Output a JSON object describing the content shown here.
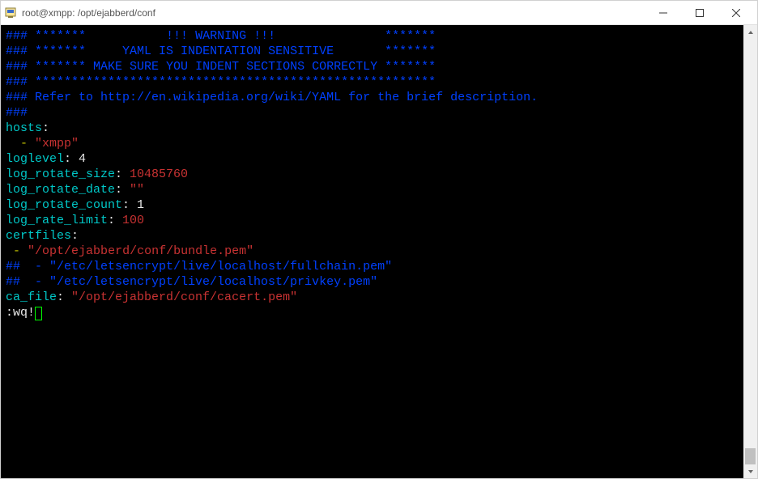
{
  "titlebar": {
    "title": "root@xmpp: /opt/ejabberd/conf"
  },
  "terminal": {
    "lines": [
      [
        {
          "cls": "c-blue",
          "text": "###"
        },
        {
          "cls": "c-white",
          "text": " "
        },
        {
          "cls": "c-blue",
          "text": "*******           !!! WARNING !!!               *******"
        }
      ],
      [
        {
          "cls": "c-blue",
          "text": "###"
        },
        {
          "cls": "c-white",
          "text": " "
        },
        {
          "cls": "c-blue",
          "text": "*******     YAML IS INDENTATION SENSITIVE       *******"
        }
      ],
      [
        {
          "cls": "c-blue",
          "text": "###"
        },
        {
          "cls": "c-white",
          "text": " "
        },
        {
          "cls": "c-blue",
          "text": "******* MAKE SURE YOU INDENT SECTIONS CORRECTLY *******"
        }
      ],
      [
        {
          "cls": "c-blue",
          "text": "###"
        },
        {
          "cls": "c-white",
          "text": " "
        },
        {
          "cls": "c-blue",
          "text": "*******************************************************"
        }
      ],
      [
        {
          "cls": "c-blue",
          "text": "### Refer to http://en.wikipedia.org/wiki/YAML for the brief description."
        }
      ],
      [
        {
          "cls": "c-blue",
          "text": "###"
        }
      ],
      [
        {
          "cls": "c-white",
          "text": ""
        }
      ],
      [
        {
          "cls": "c-cyan",
          "text": "hosts"
        },
        {
          "cls": "c-white",
          "text": ":"
        }
      ],
      [
        {
          "cls": "c-white",
          "text": "  "
        },
        {
          "cls": "c-yellow",
          "text": "-"
        },
        {
          "cls": "c-white",
          "text": " "
        },
        {
          "cls": "c-red",
          "text": "\"xmpp\""
        }
      ],
      [
        {
          "cls": "c-white",
          "text": ""
        }
      ],
      [
        {
          "cls": "c-cyan",
          "text": "loglevel"
        },
        {
          "cls": "c-white",
          "text": ": 4"
        }
      ],
      [
        {
          "cls": "c-cyan",
          "text": "log_rotate_size"
        },
        {
          "cls": "c-white",
          "text": ": "
        },
        {
          "cls": "c-red",
          "text": "10485760"
        }
      ],
      [
        {
          "cls": "c-cyan",
          "text": "log_rotate_date"
        },
        {
          "cls": "c-white",
          "text": ": "
        },
        {
          "cls": "c-red",
          "text": "\"\""
        }
      ],
      [
        {
          "cls": "c-cyan",
          "text": "log_rotate_count"
        },
        {
          "cls": "c-white",
          "text": ": 1"
        }
      ],
      [
        {
          "cls": "c-cyan",
          "text": "log_rate_limit"
        },
        {
          "cls": "c-white",
          "text": ": "
        },
        {
          "cls": "c-red",
          "text": "100"
        }
      ],
      [
        {
          "cls": "c-white",
          "text": ""
        }
      ],
      [
        {
          "cls": "c-cyan",
          "text": "certfiles"
        },
        {
          "cls": "c-white",
          "text": ":"
        }
      ],
      [
        {
          "cls": "c-white",
          "text": " "
        },
        {
          "cls": "c-yellow",
          "text": "-"
        },
        {
          "cls": "c-white",
          "text": " "
        },
        {
          "cls": "c-red",
          "text": "\"/opt/ejabberd/conf/bundle.pem\""
        }
      ],
      [
        {
          "cls": "c-blue",
          "text": "##  - \"/etc/letsencrypt/live/localhost/fullchain.pem\""
        }
      ],
      [
        {
          "cls": "c-blue",
          "text": "##  - \"/etc/letsencrypt/live/localhost/privkey.pem\""
        }
      ],
      [
        {
          "cls": "c-white",
          "text": ""
        }
      ],
      [
        {
          "cls": "c-cyan",
          "text": "ca_file"
        },
        {
          "cls": "c-white",
          "text": ": "
        },
        {
          "cls": "c-red",
          "text": "\"/opt/ejabberd/conf/cacert.pem\""
        }
      ],
      [
        {
          "cls": "c-white",
          "text": ""
        }
      ]
    ],
    "command_line_prefix": ":wq!"
  }
}
